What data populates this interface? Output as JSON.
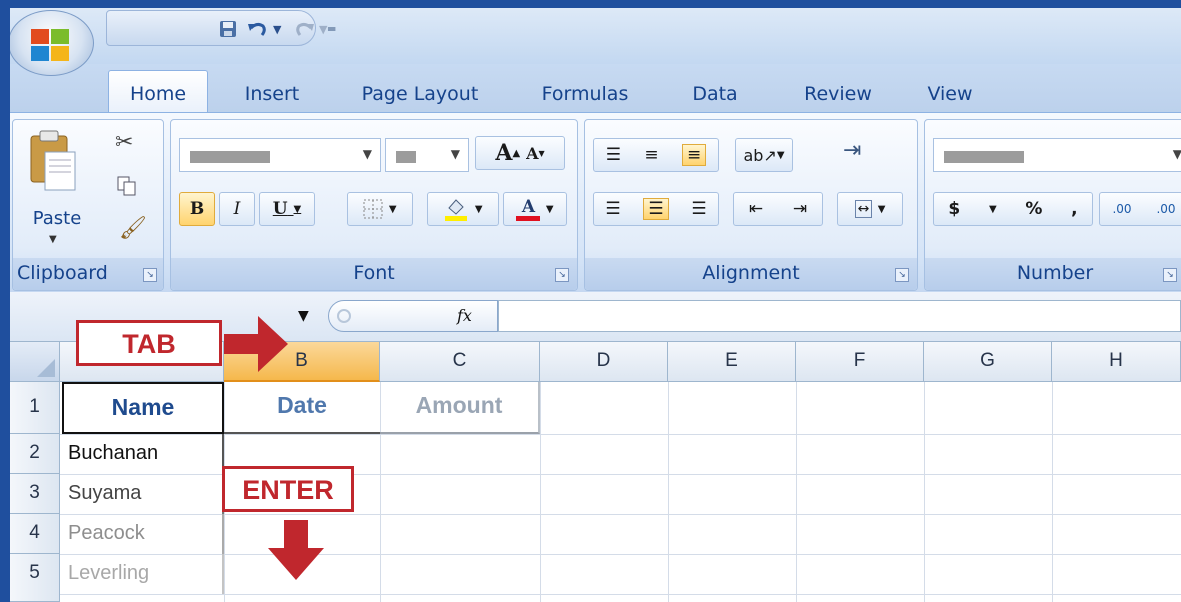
{
  "quick_access": {
    "icons": [
      "save-icon",
      "undo-icon",
      "redo-icon",
      "customize-icon"
    ]
  },
  "tabs": [
    {
      "label": "Home",
      "active": true
    },
    {
      "label": "Insert"
    },
    {
      "label": "Page Layout"
    },
    {
      "label": "Formulas"
    },
    {
      "label": "Data"
    },
    {
      "label": "Review"
    },
    {
      "label": "View"
    }
  ],
  "ribbon": {
    "clipboard": {
      "label": "Clipboard",
      "paste_label": "Paste"
    },
    "font": {
      "label": "Font",
      "bold": "B",
      "italic": "I",
      "underline": "U",
      "grow": "A",
      "shrink": "A",
      "font_color": "A"
    },
    "alignment": {
      "label": "Alignment"
    },
    "number": {
      "label": "Number",
      "currency": "$",
      "percent": "%",
      "comma": ",",
      "inc_decimal": ".00",
      "dec_decimal": ".00"
    }
  },
  "formula_bar": {
    "fx": "fx"
  },
  "grid": {
    "columns": [
      "B",
      "C",
      "D",
      "E",
      "F",
      "G",
      "H"
    ],
    "rows": [
      "1",
      "2",
      "3",
      "4",
      "5"
    ],
    "header_row": {
      "a": "Name",
      "b": "Date",
      "c": "Amount"
    },
    "names": [
      "Buchanan",
      "Suyama",
      "Peacock",
      "Leverling"
    ]
  },
  "callouts": {
    "tab": "TAB",
    "enter": "ENTER"
  },
  "colors": {
    "accent_red": "#c0272d",
    "selected_header": "#f5b84c",
    "name_blue": "#1f4b8e"
  }
}
